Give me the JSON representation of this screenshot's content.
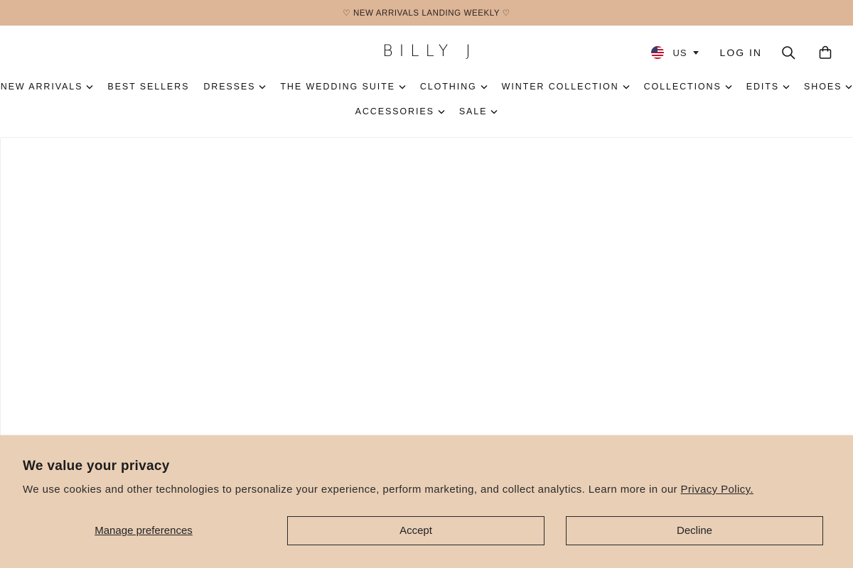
{
  "announcement": {
    "text": "♡ NEW ARRIVALS LANDING WEEKLY ♡"
  },
  "header": {
    "logo": "BILLY J",
    "country": {
      "code": "US",
      "flag_icon": "us-flag-icon"
    },
    "login_label": "LOG IN",
    "search_icon": "search-icon",
    "cart_icon": "shopping-bag-icon"
  },
  "nav": {
    "row1": [
      {
        "label": "NEW ARRIVALS",
        "has_dropdown": true
      },
      {
        "label": "BEST SELLERS",
        "has_dropdown": false
      },
      {
        "label": "DRESSES",
        "has_dropdown": true
      },
      {
        "label": "THE WEDDING SUITE",
        "has_dropdown": true
      },
      {
        "label": "CLOTHING",
        "has_dropdown": true
      },
      {
        "label": "WINTER COLLECTION",
        "has_dropdown": true
      },
      {
        "label": "COLLECTIONS",
        "has_dropdown": true
      },
      {
        "label": "EDITS",
        "has_dropdown": true
      },
      {
        "label": "SHOES",
        "has_dropdown": true
      }
    ],
    "row2": [
      {
        "label": "ACCESSORIES",
        "has_dropdown": true
      },
      {
        "label": "SALE",
        "has_dropdown": true
      }
    ]
  },
  "cookie_banner": {
    "title": "We value your privacy",
    "text": "We use cookies and other technologies to personalize your experience, perform marketing, and collect analytics. Learn more in our ",
    "link_label": "Privacy Policy.",
    "manage_label": "Manage preferences",
    "accept_label": "Accept",
    "decline_label": "Decline"
  },
  "colors": {
    "announcement_bg": "#ddb597",
    "cookie_bg": "#e9cfb6",
    "text": "#1a1a1a"
  }
}
